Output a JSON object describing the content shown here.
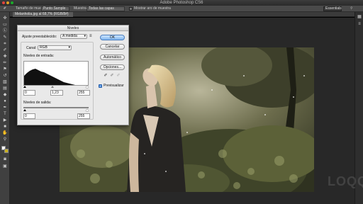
{
  "window": {
    "title": "Adobe Photoshop CS6"
  },
  "options_bar": {
    "sample_size_label": "Tamaño de muestra:",
    "sample_size_value": "Punto Sample",
    "sample_label": "Muestra:",
    "sample_value": "Todas las capas",
    "show_ring_label": "Mostrar aro de muestra",
    "workspace_value": "Essentials"
  },
  "document_tab": {
    "label": "Melanholia.jpg al 68,7% (RGB/8#)"
  },
  "levels_dialog": {
    "title": "Niveles",
    "preset_label": "Ajuste preestablecido:",
    "preset_value": "A medida",
    "channel_label": "Canal:",
    "channel_value": "RGB",
    "input_levels_label": "Niveles de entrada:",
    "input_black": "0",
    "input_gamma": "1,23",
    "input_white": "255",
    "output_levels_label": "Niveles de salida:",
    "output_black": "0",
    "output_white": "255",
    "ok_label": "OK",
    "cancel_label": "Cancelar",
    "auto_label": "Automático",
    "options_label": "Opciones...",
    "preview_label": "Previsualizar",
    "preview_checked": true
  },
  "watermark": {
    "text": "LOQQ"
  },
  "colors": {
    "accent": "#7fb5ee",
    "workspace_bg": "#282828",
    "panel_bg": "#404040",
    "dialog_bg": "#e9e9e9"
  }
}
